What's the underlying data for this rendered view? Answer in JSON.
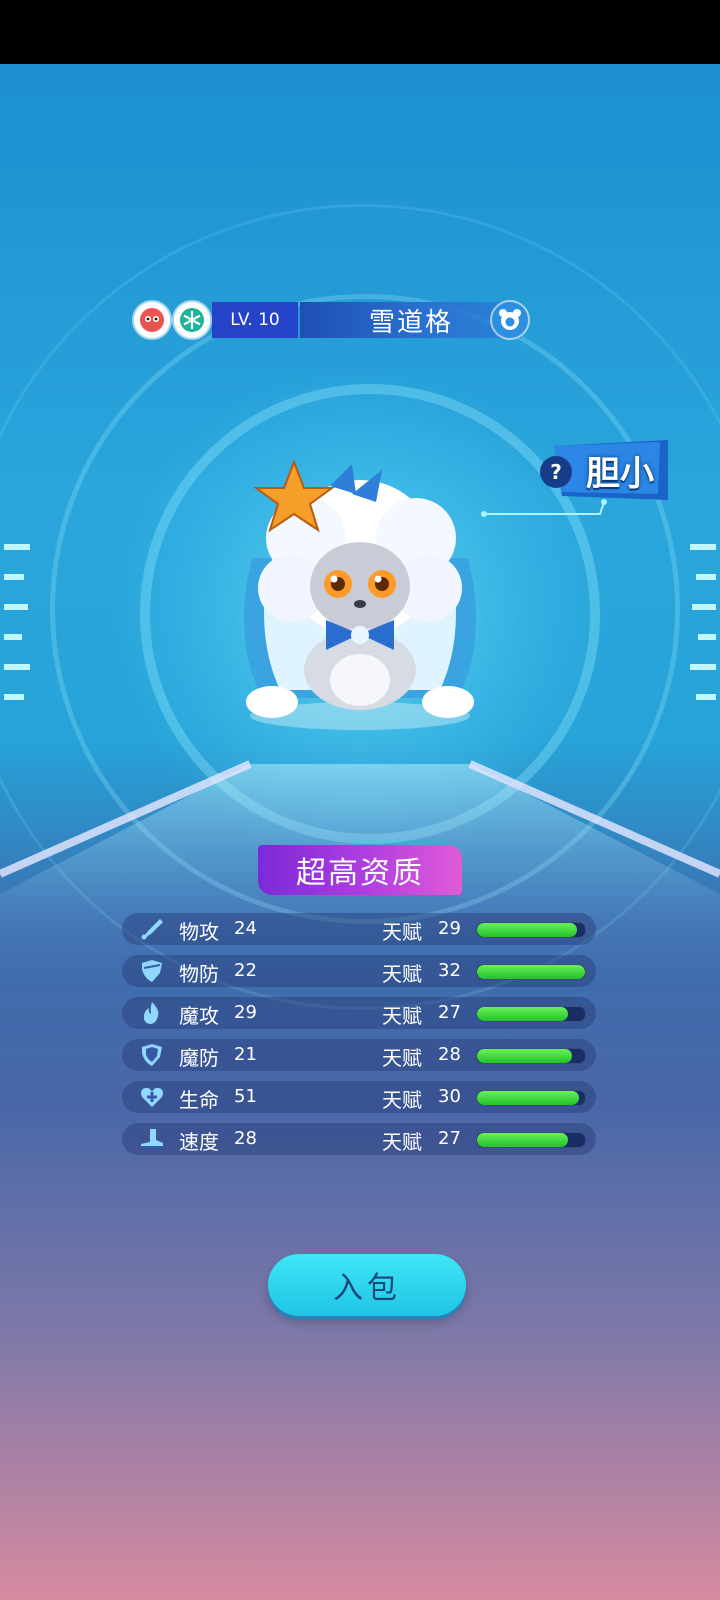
{
  "pet": {
    "level_label": "LV. 10",
    "name": "雪道格",
    "element_icons": [
      "red-monster-type-icon",
      "snowflake-ice-type-icon"
    ],
    "extra_icon": "blue-bear-face-icon",
    "trait": {
      "label": "胆小",
      "icon": "question-mark-icon"
    }
  },
  "quality_label": "超高资质",
  "stats": [
    {
      "icon": "sword-icon",
      "name": "物攻",
      "value": "24",
      "talent_label": "天赋",
      "talent": "29",
      "fill": 0.93
    },
    {
      "icon": "shield-icon",
      "name": "物防",
      "value": "22",
      "talent_label": "天赋",
      "talent": "32",
      "fill": 1.0
    },
    {
      "icon": "fire-icon",
      "name": "魔攻",
      "value": "29",
      "talent_label": "天赋",
      "talent": "27",
      "fill": 0.84
    },
    {
      "icon": "magic-shield-icon",
      "name": "魔防",
      "value": "21",
      "talent_label": "天赋",
      "talent": "28",
      "fill": 0.88
    },
    {
      "icon": "heart-plus-icon",
      "name": "生命",
      "value": "51",
      "talent_label": "天赋",
      "talent": "30",
      "fill": 0.94
    },
    {
      "icon": "boot-icon",
      "name": "速度",
      "value": "28",
      "talent_label": "天赋",
      "talent": "27",
      "fill": 0.84
    }
  ],
  "bag_button_label": "入包",
  "colors": {
    "accent_blue": "#2543c9",
    "quality_purple": "#b13fe0",
    "bar_green": "#22c22a",
    "button_cyan": "#1fc5e6"
  }
}
